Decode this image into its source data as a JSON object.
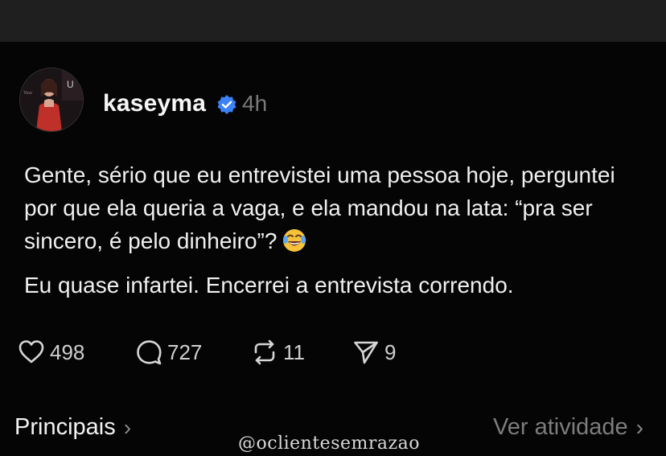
{
  "post": {
    "username": "kaseyma",
    "time": "4h",
    "paragraph1": "Gente, sério que eu entrevistei uma pessoa hoje, perguntei por que ela queria a vaga, e ela mandou na lata: “pra ser sincero, é pelo dinheiro”?",
    "paragraph2": "Eu quase infartei. Encerrei a entrevista correndo."
  },
  "actions": {
    "likes": "498",
    "replies": "727",
    "reposts": "11",
    "shares": "9"
  },
  "footer": {
    "left_label": "Principais",
    "right_label": "Ver atividade",
    "chevron": "›"
  },
  "watermark": "@oclientesemrazao",
  "icons": {
    "verified": "verified-badge-icon",
    "emoji": "face-with-tears-of-joy-icon",
    "like": "heart-icon",
    "reply": "comment-bubble-icon",
    "repost": "repost-arrows-icon",
    "share": "send-paper-plane-icon"
  },
  "colors": {
    "background": "#050505",
    "verified_blue": "#3b82f6",
    "muted_text": "#7a7a7a"
  }
}
